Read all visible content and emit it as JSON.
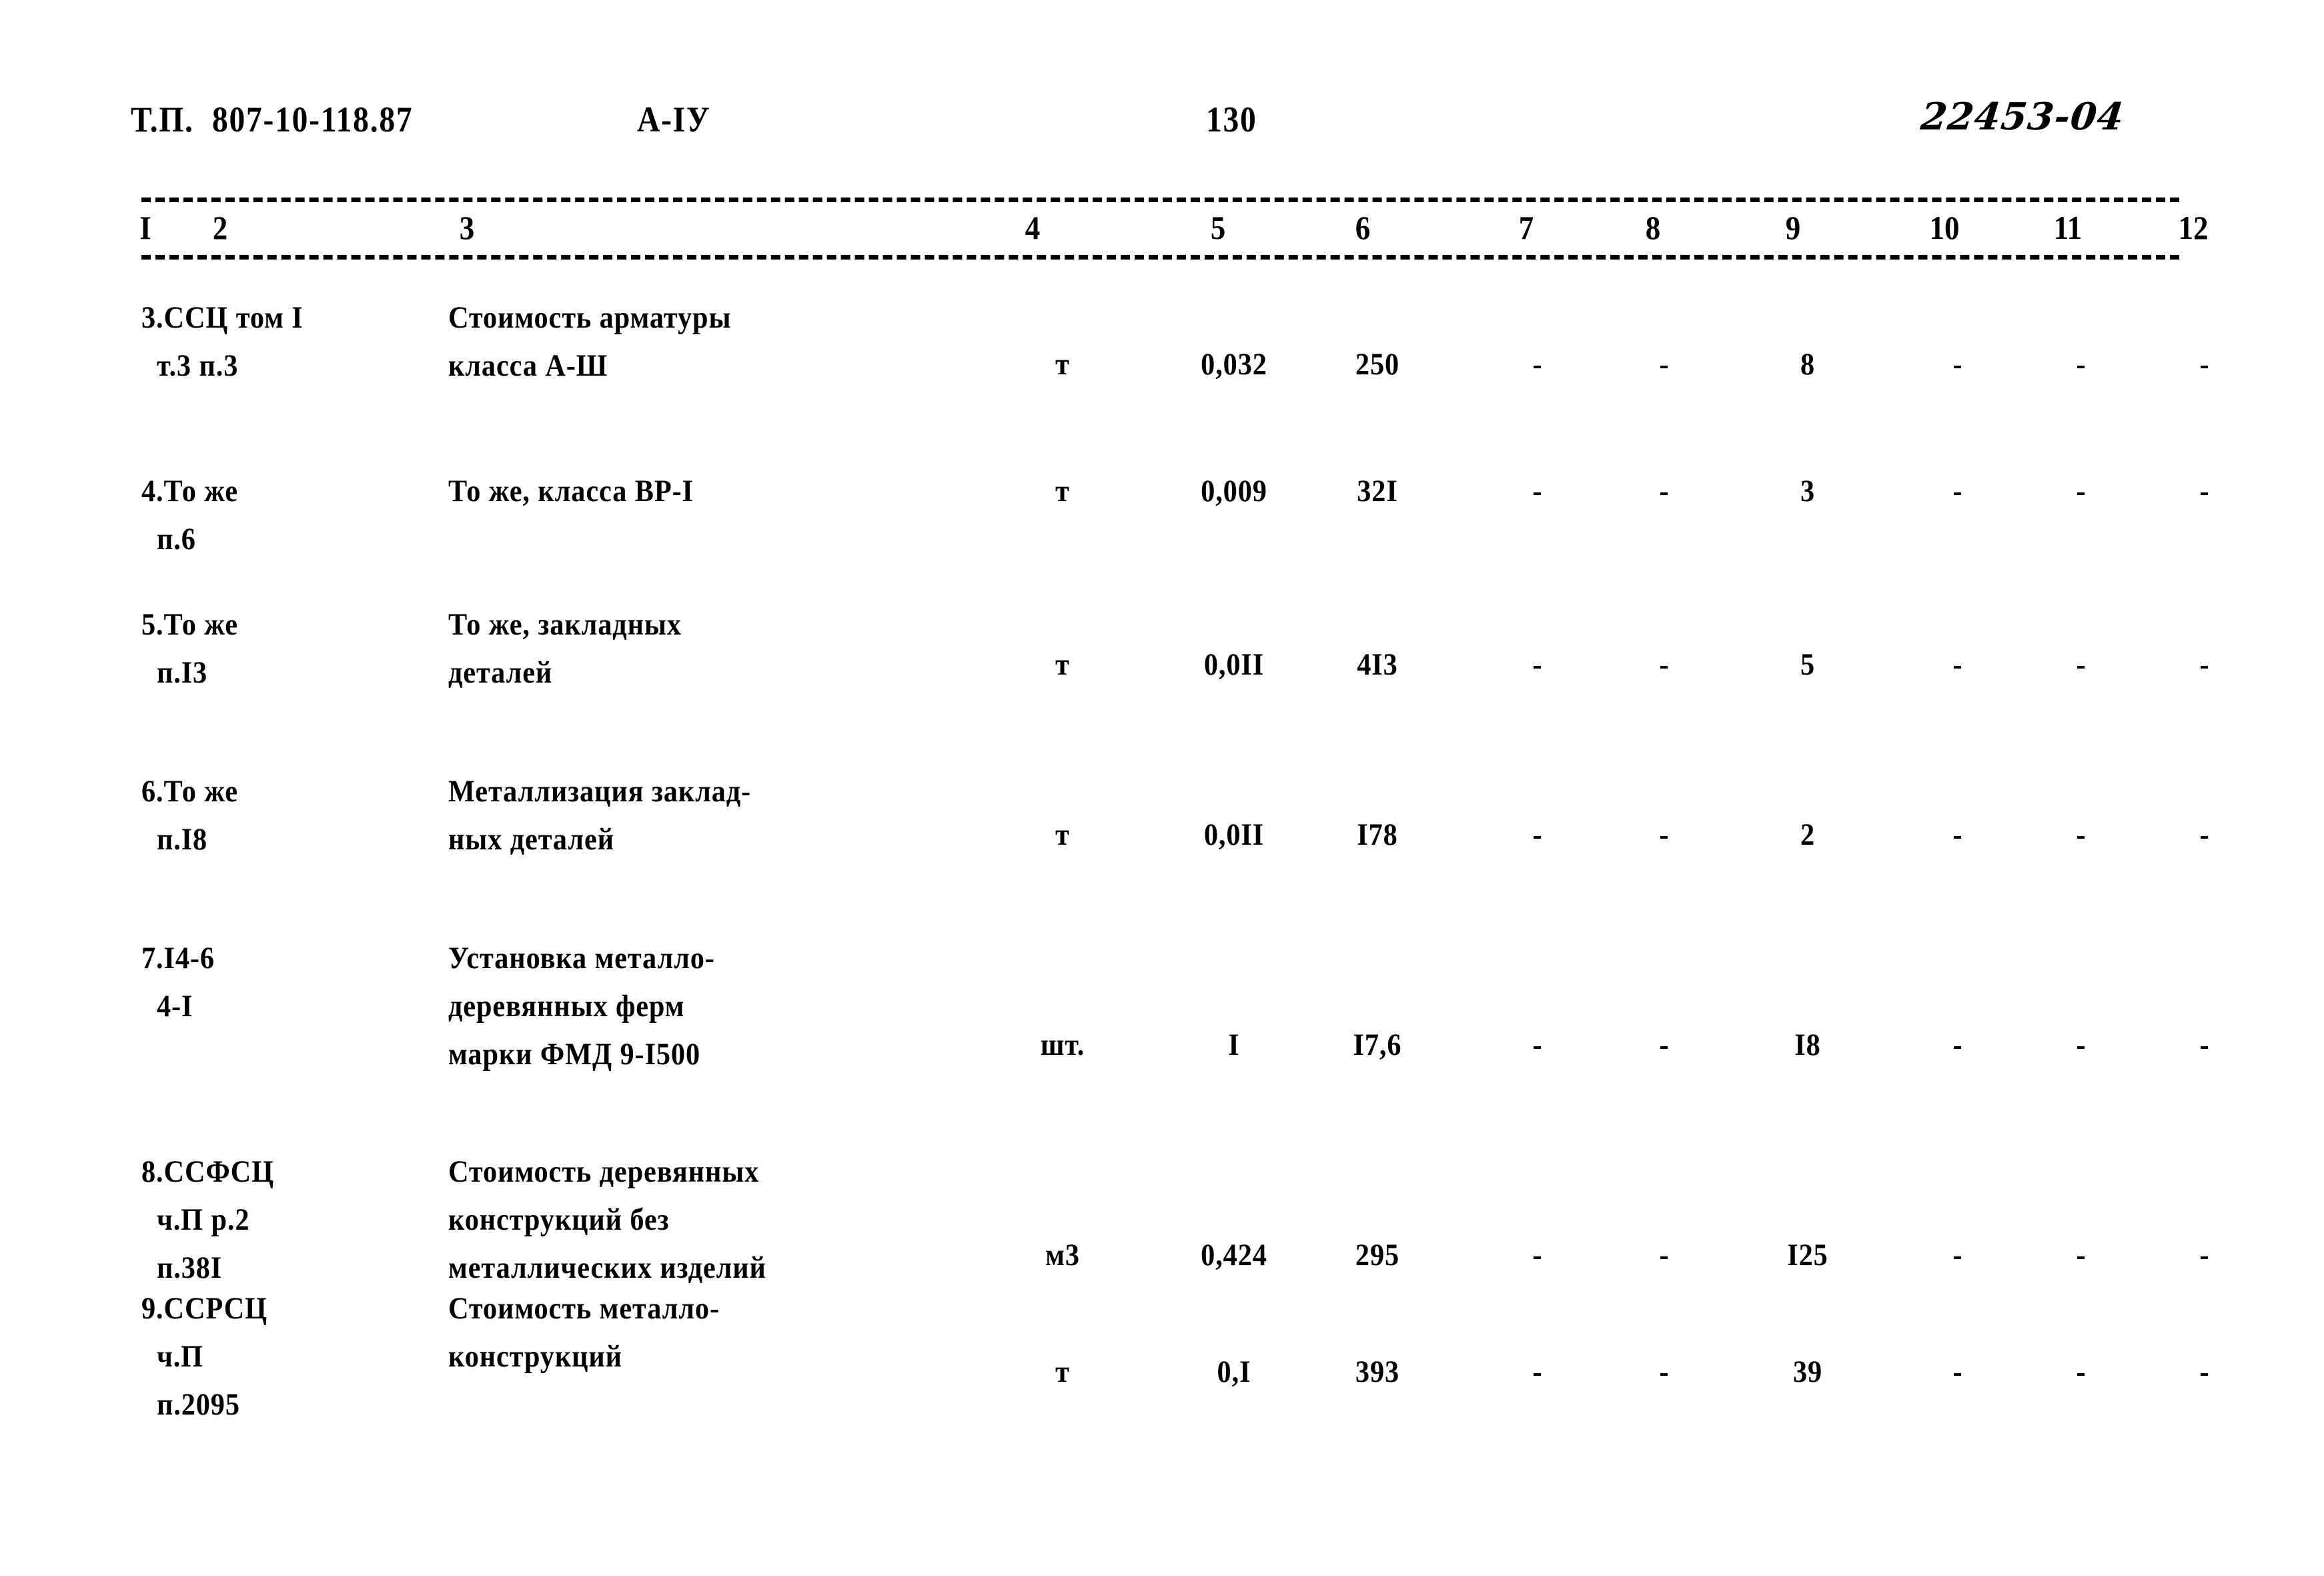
{
  "header": {
    "doc_code": "Т.П.  807-10-118.87",
    "doc_mark": "А-IУ",
    "page_number": "130",
    "stamp": "22453-04"
  },
  "table": {
    "column_numbers": [
      "I",
      "2",
      "3",
      "4",
      "5",
      "6",
      "7",
      "8",
      "9",
      "10",
      "11",
      "12"
    ],
    "rows": [
      {
        "ref": "3.ССЦ том I\n  т.3 п.3",
        "description": "Стоимость арматуры\nкласса А-Ш",
        "unit": "т",
        "c5": "0,032",
        "c6": "250",
        "c7": "-",
        "c8": "-",
        "c9": "8",
        "c10": "-",
        "c11": "-",
        "c12": "-"
      },
      {
        "ref": "4.То же\n  п.6",
        "description": "То же, класса ВР-I",
        "unit": "т",
        "c5": "0,009",
        "c6": "32I",
        "c7": "-",
        "c8": "-",
        "c9": "3",
        "c10": "-",
        "c11": "-",
        "c12": "-"
      },
      {
        "ref": "5.То же\n  п.I3",
        "description": "То же, закладных\nдеталей",
        "unit": "т",
        "c5": "0,0II",
        "c6": "4I3",
        "c7": "-",
        "c8": "-",
        "c9": "5",
        "c10": "-",
        "c11": "-",
        "c12": "-"
      },
      {
        "ref": "6.То же\n  п.I8",
        "description": "Металлизация заклад-\nных деталей",
        "unit": "т",
        "c5": "0,0II",
        "c6": "I78",
        "c7": "-",
        "c8": "-",
        "c9": "2",
        "c10": "-",
        "c11": "-",
        "c12": "-"
      },
      {
        "ref": "7.I4-6\n  4-I",
        "description": "Установка металло-\nдеревянных ферм\nмарки ФМД 9-I500",
        "unit": "шт.",
        "c5": "I",
        "c6": "I7,6",
        "c7": "-",
        "c8": "-",
        "c9": "I8",
        "c10": "-",
        "c11": "-",
        "c12": "-"
      },
      {
        "ref": "8.ССФСЦ\n  ч.П р.2\n  п.38I",
        "description": "Стоимость деревянных\nконструкций без\nметаллических изделий",
        "unit": "м3",
        "c5": "0,424",
        "c6": "295",
        "c7": "-",
        "c8": "-",
        "c9": "I25",
        "c10": "-",
        "c11": "-",
        "c12": "-"
      },
      {
        "ref": "9.ССРСЦ\n  ч.П\n  п.2095",
        "description": "Стоимость металло-\nконструкций",
        "unit": "т",
        "c5": "0,I",
        "c6": "393",
        "c7": "-",
        "c8": "-",
        "c9": "39",
        "c10": "-",
        "c11": "-",
        "c12": "-"
      }
    ]
  },
  "layout": {
    "column_number_x": [
      218,
      330,
      700,
      1548,
      1826,
      2043,
      2288,
      2478,
      2688,
      2915,
      3100,
      3288
    ],
    "row_tops": [
      440,
      700,
      900,
      1150,
      1400,
      1720,
      1925
    ],
    "row_ref_tops": [
      440,
      700,
      900,
      1150,
      1400,
      1720,
      1925
    ],
    "row_desc_tops": [
      440,
      700,
      900,
      1150,
      1400,
      1720,
      1925
    ],
    "row_value_tops": [
      510,
      700,
      960,
      1215,
      1530,
      1845,
      2020
    ]
  }
}
